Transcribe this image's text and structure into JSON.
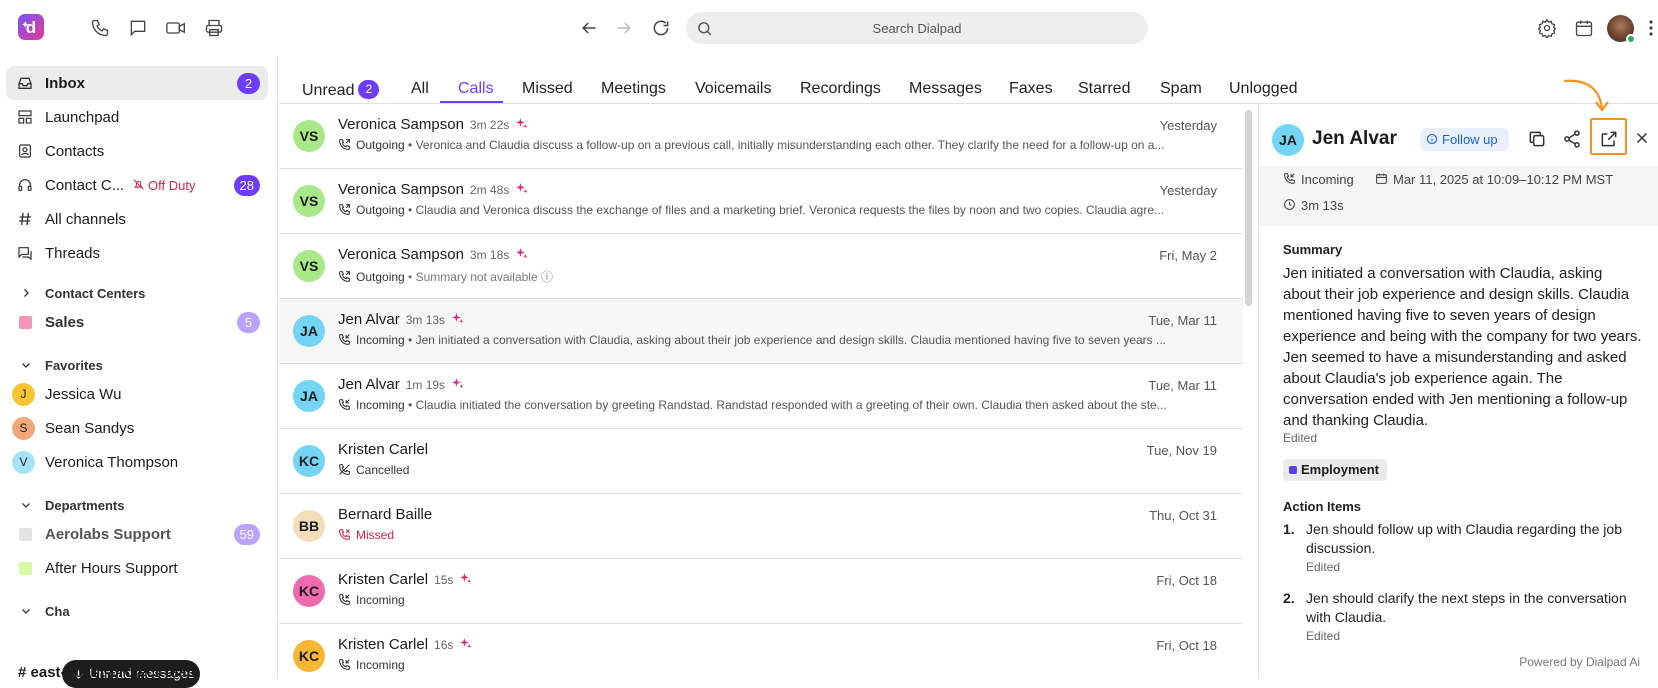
{
  "topbar": {
    "logo_letter": "d",
    "search_placeholder": "Search Dialpad"
  },
  "sidebar": {
    "inbox": {
      "label": "Inbox",
      "badge": "2"
    },
    "launchpad": {
      "label": "Launchpad"
    },
    "contacts": {
      "label": "Contacts"
    },
    "contact_center": {
      "label": "Contact C...",
      "status": "Off Duty",
      "badge": "28"
    },
    "all_channels": {
      "label": "All channels"
    },
    "threads": {
      "label": "Threads"
    },
    "contact_centers_header": "Contact Centers",
    "sales": {
      "label": "Sales",
      "badge": "5",
      "color": "#f596b8"
    },
    "favorites_header": "Favorites",
    "favorites": [
      {
        "initial": "J",
        "name": "Jessica Wu",
        "color": "#f7c531"
      },
      {
        "initial": "S",
        "name": "Sean Sandys",
        "color": "#f0a87a"
      },
      {
        "initial": "V",
        "name": "Veronica Thompson",
        "color": "#a7e3f7"
      }
    ],
    "departments_header": "Departments",
    "aerolabs": {
      "label": "Aerolabs Support",
      "badge": "59",
      "color": "#e3e3e3"
    },
    "after_hours": {
      "label": "After Hours Support",
      "color": "#d8f9a8"
    },
    "channels_header_partial": "Cha",
    "toast": "Unread messages",
    "channel_partial": "east-coast-project-team"
  },
  "tabs": [
    {
      "label": "Unread",
      "badge": "2"
    },
    {
      "label": "All"
    },
    {
      "label": "Calls",
      "active": true
    },
    {
      "label": "Missed"
    },
    {
      "label": "Meetings"
    },
    {
      "label": "Voicemails"
    },
    {
      "label": "Recordings"
    },
    {
      "label": "Messages"
    },
    {
      "label": "Faxes"
    },
    {
      "label": "Starred"
    },
    {
      "label": "Spam"
    },
    {
      "label": "Unlogged"
    }
  ],
  "calls": [
    {
      "initials": "VS",
      "name": "Veronica Sampson",
      "duration": "3m 22s",
      "ai": true,
      "date": "Yesterday",
      "direction": "Outgoing",
      "summary": " • Veronica and Claudia discuss a follow-up on a previous call, initially misunderstanding each other. They clarify the need for a follow-up on a..."
    },
    {
      "initials": "VS",
      "name": "Veronica Sampson",
      "duration": "2m 48s",
      "ai": true,
      "date": "Yesterday",
      "direction": "Outgoing",
      "summary": " • Claudia and Veronica discuss the exchange of files and a marketing brief. Veronica requests the files by noon and two copies. Claudia agre..."
    },
    {
      "initials": "VS",
      "name": "Veronica Sampson",
      "duration": "3m 18s",
      "ai": true,
      "date": "Fri, May 2",
      "direction": "Outgoing",
      "summary": " • Summary not available ⓘ"
    },
    {
      "initials": "JA",
      "name": "Jen Alvar",
      "duration": "3m 13s",
      "ai": true,
      "date": "Tue, Mar 11",
      "direction": "Incoming",
      "summary": " • Jen initiated a conversation with Claudia, asking about their job experience and design skills. Claudia mentioned having five to seven years ..."
    },
    {
      "initials": "JA",
      "name": "Jen Alvar",
      "duration": "1m 19s",
      "ai": true,
      "date": "Tue, Mar 11",
      "direction": "Incoming",
      "summary": " • Claudia initiated the conversation by greeting Randstad. Randstad responded with a greeting of their own. Claudia then asked about the ste..."
    },
    {
      "initials": "KC",
      "name": "Kristen Carlel",
      "duration": "",
      "ai": false,
      "date": "Tue, Nov 19",
      "direction": "Cancelled",
      "summary": ""
    },
    {
      "initials": "BB",
      "name": "Bernard Baille",
      "duration": "",
      "ai": false,
      "date": "Thu, Oct 31",
      "direction": "Missed",
      "summary": ""
    },
    {
      "initials": "KC",
      "name": "Kristen Carlel",
      "duration": "15s",
      "ai": true,
      "date": "Fri, Oct 18",
      "direction": "Incoming",
      "summary": ""
    },
    {
      "initials": "KC",
      "name": "Kristen Carlel",
      "duration": "16s",
      "ai": true,
      "date": "Fri, Oct 18",
      "direction": "Incoming",
      "summary": ""
    }
  ],
  "panel": {
    "initials": "JA",
    "name": "Jen Alvar",
    "follow_up": "Follow up",
    "direction": "Incoming",
    "datetime": "Mar 11, 2025 at 10:09–10:12 PM MST",
    "duration": "3m 13s",
    "summary_heading": "Summary",
    "summary_text": "Jen initiated a conversation with Claudia, asking about their job experience and design skills. Claudia mentioned having five to seven years of design experience and being with the company for two years. Jen seemed to have a misunderstanding and asked about Claudia's job experience again. The conversation ended with Jen mentioning a follow-up and thanking Claudia.",
    "summary_edited": "Edited",
    "tag": "Employment",
    "action_items_heading": "Action Items",
    "action_items": [
      {
        "num": "1.",
        "text": "Jen should follow up with Claudia regarding the job discussion.",
        "edited": "Edited"
      },
      {
        "num": "2.",
        "text": "Jen should clarify the next steps in the conversation with Claudia.",
        "edited": "Edited"
      }
    ],
    "powered_by": "Powered by Dialpad Ai"
  },
  "colors": {
    "accent": "#6c3dff",
    "highlight": "#f5921e",
    "ai_sparkle": "#e0287a",
    "missed": "#d1244d"
  }
}
